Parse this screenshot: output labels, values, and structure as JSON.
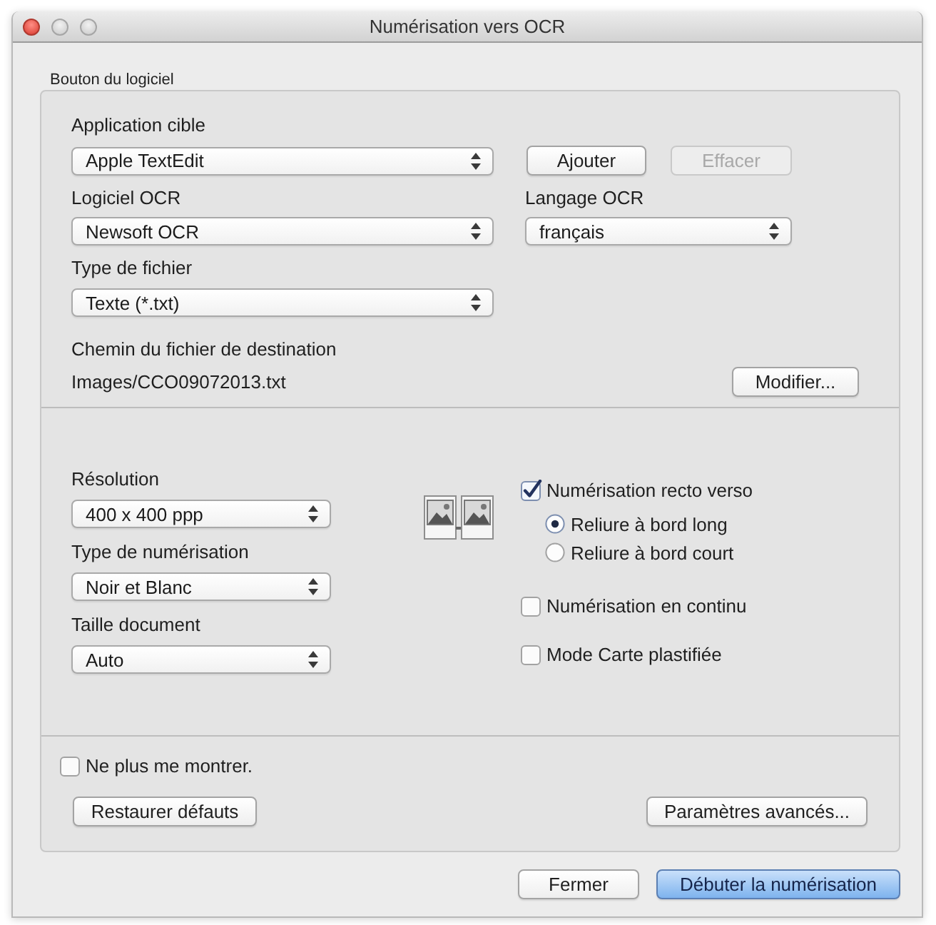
{
  "window": {
    "title": "Numérisation vers OCR"
  },
  "group_label": "Bouton du logiciel",
  "software": {
    "target_app": {
      "label": "Application cible",
      "value": "Apple TextEdit"
    },
    "app_buttons": [
      {
        "label": "Ajouter",
        "disabled": false
      },
      {
        "label": "Effacer",
        "disabled": true
      }
    ],
    "ocr_software": {
      "label": "Logiciel OCR",
      "value": "Newsoft OCR"
    },
    "ocr_language": {
      "label": "Langage OCR",
      "value": "français"
    },
    "file_type": {
      "label": "Type de fichier",
      "value": "Texte (*.txt)"
    },
    "destination": {
      "label": "Chemin du fichier de destination",
      "path": "Images/CCO09072013.txt",
      "button": "Modifier..."
    }
  },
  "scan": {
    "selects": [
      {
        "label": "Résolution",
        "value": "400 x 400 ppp"
      },
      {
        "label": "Type de numérisation",
        "value": "Noir et Blanc"
      },
      {
        "label": "Taille document",
        "value": "Auto"
      }
    ],
    "duplex": {
      "label": "Numérisation recto verso",
      "checked": true,
      "options": [
        {
          "label": "Reliure à bord long",
          "selected": true
        },
        {
          "label": "Reliure à bord court",
          "selected": false
        }
      ]
    },
    "options": [
      {
        "label": "Numérisation en continu",
        "checked": false
      },
      {
        "label": "Mode Carte plastifiée",
        "checked": false
      }
    ]
  },
  "footer": {
    "dont_show": {
      "label": "Ne plus me montrer.",
      "checked": false
    },
    "buttons": [
      {
        "label": "Restaurer défauts"
      },
      {
        "label": "Paramètres avancés..."
      }
    ]
  },
  "actions": [
    {
      "label": "Fermer",
      "default": false
    },
    {
      "label": "Débuter la numérisation",
      "default": true
    }
  ]
}
